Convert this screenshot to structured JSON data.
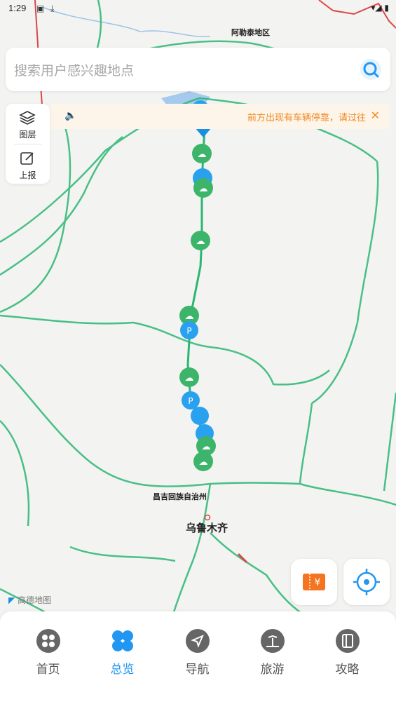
{
  "status_bar": {
    "time": "1:29"
  },
  "map": {
    "labels": {
      "altay": "阿勒泰地区",
      "changji": "昌吉回族自治州",
      "urumqi": "乌鲁木齐"
    },
    "logo": "高德地图"
  },
  "search": {
    "placeholder": "搜索用户感兴趣地点"
  },
  "notice": {
    "text": "前方出现有车辆停靠，请过往"
  },
  "tools": {
    "layers_label": "图层",
    "report_label": "上报"
  },
  "colors": {
    "accent": "#2196f3",
    "road": "#2bb673",
    "notice": "#f08a24"
  },
  "tabs": [
    {
      "label": "首页",
      "icon": "home-icon"
    },
    {
      "label": "总览",
      "icon": "overview-icon",
      "active": true
    },
    {
      "label": "导航",
      "icon": "navigation-icon"
    },
    {
      "label": "旅游",
      "icon": "travel-icon"
    },
    {
      "label": "攻略",
      "icon": "guide-icon"
    }
  ]
}
